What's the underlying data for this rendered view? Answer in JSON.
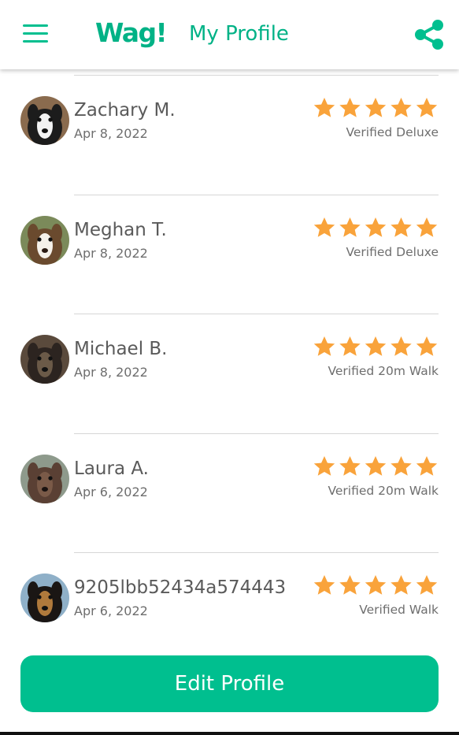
{
  "colors": {
    "brand": "#00bf8f",
    "brand_text": "#00b286",
    "star": "#f9a33b",
    "text": "#555555"
  },
  "header": {
    "menu_icon": "hamburger-menu-icon",
    "logo": "Wag!",
    "title": "My Profile",
    "share_icon": "share-icon"
  },
  "reviews": [
    {
      "name": "Zachary M.",
      "date": "Apr 8, 2022",
      "rating": 5,
      "service": "Verified Deluxe",
      "avatar": "dog-photo"
    },
    {
      "name": "Meghan T.",
      "date": "Apr 8, 2022",
      "rating": 5,
      "service": "Verified Deluxe",
      "avatar": "dog-photo"
    },
    {
      "name": "Michael B.",
      "date": "Apr 8, 2022",
      "rating": 5,
      "service": "Verified 20m Walk",
      "avatar": "dog-photo"
    },
    {
      "name": "Laura A.",
      "date": "Apr 6, 2022",
      "rating": 5,
      "service": "Verified 20m Walk",
      "avatar": "dog-photo"
    },
    {
      "name": "9205lbb52434a574443",
      "date": "Apr 6, 2022",
      "rating": 5,
      "service": "Verified Walk",
      "avatar": "dog-photo"
    }
  ],
  "edit_button": "Edit Profile"
}
